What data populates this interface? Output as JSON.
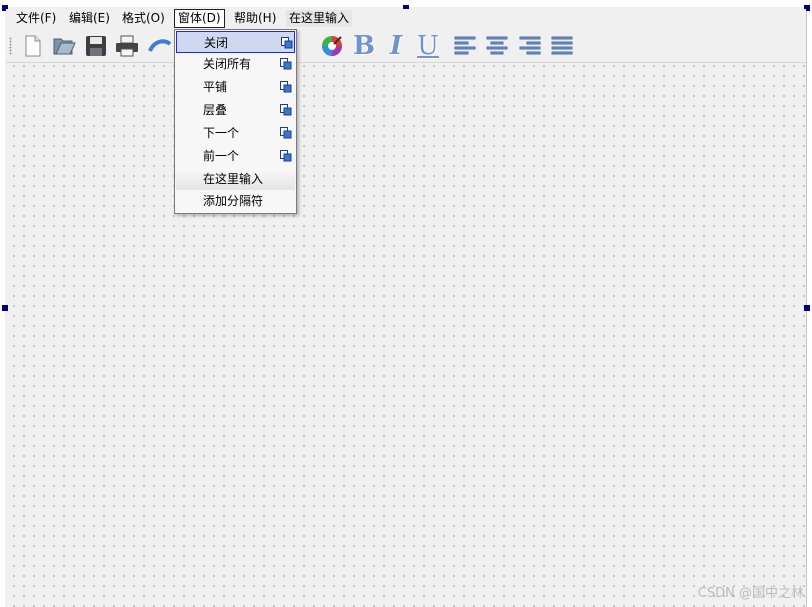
{
  "menubar": {
    "items": [
      {
        "label": "文件(F)"
      },
      {
        "label": "编辑(E)"
      },
      {
        "label": "格式(O)"
      },
      {
        "label": "窗体(D)"
      },
      {
        "label": "帮助(H)"
      },
      {
        "label": "在这里输入"
      }
    ]
  },
  "toolbar": {
    "buttons": [
      "new-file-icon",
      "open-folder-icon",
      "save-icon",
      "print-icon",
      "undo-icon",
      "color-palette-icon"
    ],
    "format": {
      "bold": "B",
      "italic": "I",
      "underline": "U"
    },
    "align": [
      "align-left-icon",
      "align-center-icon",
      "align-right-icon",
      "justify-icon"
    ]
  },
  "dropdown": {
    "items": [
      {
        "label": "关闭",
        "selected": true
      },
      {
        "label": "关闭所有"
      },
      {
        "label": "平铺"
      },
      {
        "label": "层叠"
      },
      {
        "label": "下一个"
      },
      {
        "label": "前一个"
      },
      {
        "label": "在这里输入"
      },
      {
        "label": "添加分隔符"
      }
    ]
  },
  "watermark": "CSDN @国中之林"
}
